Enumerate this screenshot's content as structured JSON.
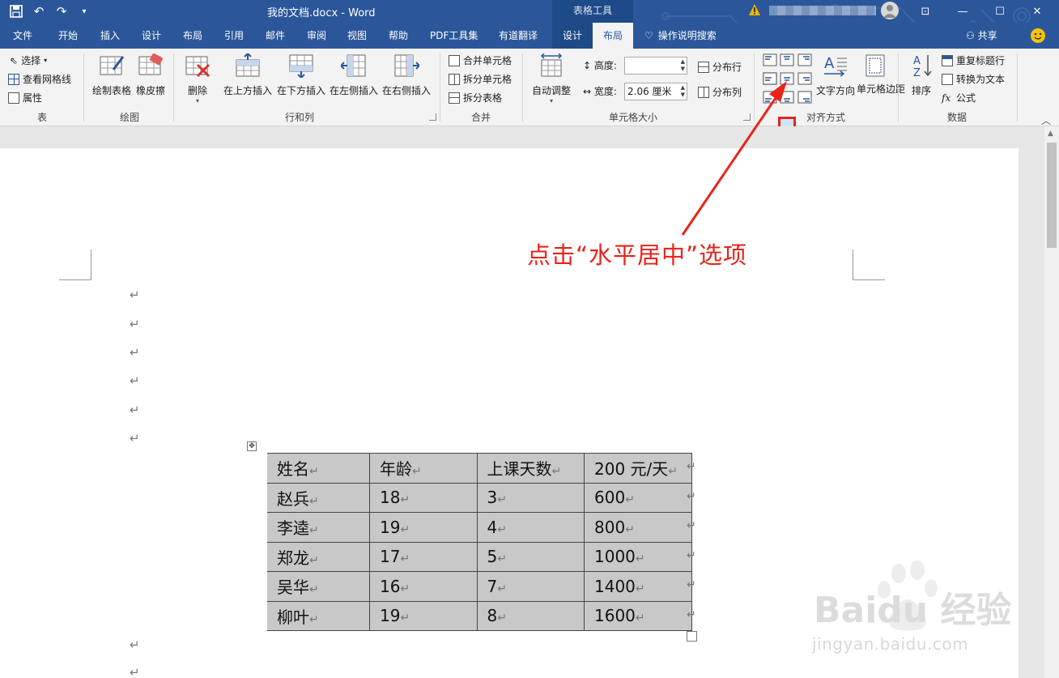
{
  "window": {
    "title": "我的文档.docx  -  Word",
    "context_tab_header": "表格工具",
    "share_label": "共享",
    "tell_me": "操作说明搜索"
  },
  "tabs": [
    "文件",
    "开始",
    "插入",
    "设计",
    "布局",
    "引用",
    "邮件",
    "审阅",
    "视图",
    "帮助",
    "PDF工具集",
    "有道翻译",
    "设计",
    "布局"
  ],
  "active_tab_index": 13,
  "ribbon": {
    "table_group": {
      "label": "表",
      "select": "选择",
      "view_gridlines": "查看网格线",
      "properties": "属性"
    },
    "draw_group": {
      "label": "绘图",
      "draw_table": "绘制表格",
      "eraser": "橡皮擦"
    },
    "rows_cols_group": {
      "label": "行和列",
      "delete": "删除",
      "insert_above": "在上方插入",
      "insert_below": "在下方插入",
      "insert_left": "在左侧插入",
      "insert_right": "在右侧插入"
    },
    "merge_group": {
      "label": "合并",
      "merge_cells": "合并单元格",
      "split_cells": "拆分单元格",
      "split_table": "拆分表格"
    },
    "cell_size_group": {
      "label": "单元格大小",
      "autofit": "自动调整",
      "height_label": "高度:",
      "height_value": "",
      "width_label": "宽度:",
      "width_value": "2.06 厘米",
      "distribute_rows": "分布行",
      "distribute_cols": "分布列"
    },
    "alignment_group": {
      "label": "对齐方式",
      "text_direction": "文字方向",
      "cell_margins": "单元格边距"
    },
    "data_group": {
      "label": "数据",
      "sort": "排序",
      "repeat_header": "重复标题行",
      "convert_to_text": "转换为文本",
      "formula": "公式"
    }
  },
  "document": {
    "table": {
      "rows": [
        [
          "姓名",
          "年龄",
          "上课天数",
          "200 元/天"
        ],
        [
          "赵兵",
          "18",
          "3",
          "600"
        ],
        [
          "李逵",
          "19",
          "4",
          "800"
        ],
        [
          "郑龙",
          "17",
          "5",
          "1000"
        ],
        [
          "吴华",
          "16",
          "7",
          "1400"
        ],
        [
          "柳叶",
          "19",
          "8",
          "1600"
        ]
      ]
    },
    "paragraph_mark": "↵"
  },
  "annotation": "点击“水平居中”选项",
  "watermark": {
    "brand": "Baidu 经验",
    "url": "jingyan.baidu.com"
  },
  "colors": {
    "accent": "#2b579a",
    "annotation": "#e8241a"
  }
}
